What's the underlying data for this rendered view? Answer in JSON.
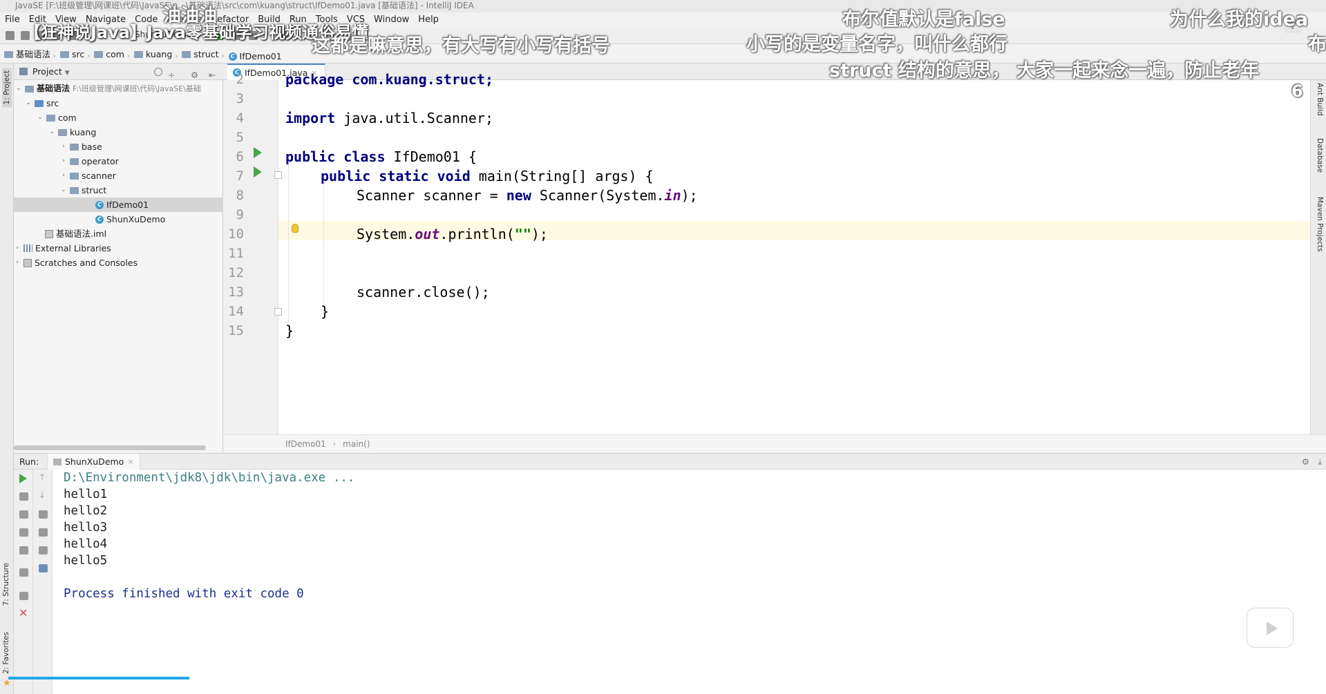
{
  "window": {
    "title": "JavaSE [F:\\班级管理\\网课班\\代码\\JavaSE\\n...\\基础语法\\src\\com\\kuang\\struct\\IfDemo01.java [基础语法] - IntelliJ IDEA",
    "logo": "IJ"
  },
  "menu": [
    "File",
    "Edit",
    "View",
    "Navigate",
    "Code",
    "Analyze",
    "Refactor",
    "Build",
    "Run",
    "Tools",
    "VCS",
    "Window",
    "Help"
  ],
  "toolbar": {
    "config_name": "ShunXuDemo"
  },
  "breadcrumb": [
    "基础语法",
    "src",
    "com",
    "kuang",
    "struct",
    "IfDemo01"
  ],
  "overlays": {
    "video_title": "【狂神说Java】Java零基础学习视频通俗易懂",
    "danmaku": [
      "油油油",
      "这都是嘛意思，有大写有小写有括号",
      "布尔值默认是false",
      "小写的是变量名字，叫什么都行",
      "struct 结构的意思， 大家一起来念一遍，防止老年",
      "为什么我的idea",
      "布",
      "6"
    ],
    "help": "?"
  },
  "left_stripe": {
    "project_tab": "1: Project",
    "structure_tab": "7: Structure",
    "favorites_tab": "2: Favorites"
  },
  "project": {
    "header": "Project",
    "root_name": "基础语法",
    "root_path": "F:\\班级管理\\网课班\\代码\\JavaSE\\基础",
    "nodes": [
      "src",
      "com",
      "kuang",
      "base",
      "operator",
      "scanner",
      "struct",
      "IfDemo01",
      "ShunXuDemo",
      "基础语法.iml",
      "External Libraries",
      "Scratches and Consoles"
    ]
  },
  "editor": {
    "tab": "IfDemo01.java",
    "line_numbers": [
      "2",
      "3",
      "4",
      "5",
      "6",
      "7",
      "8",
      "9",
      "10",
      "11",
      "12",
      "13",
      "14",
      "15"
    ],
    "partial_line": "package com.kuang.struct;",
    "breadcrumb": [
      "IfDemo01",
      "main()"
    ],
    "code": {
      "import_kw": "import",
      "import_rest": " java.util.Scanner;",
      "class_kw": "public class",
      "class_rest": " IfDemo01 {",
      "main_kw": "public static void",
      "main_rest": " main(String[] args) {",
      "scanner_a": "Scanner scanner = ",
      "scanner_new": "new",
      "scanner_b": " Scanner(System.",
      "scanner_in": "in",
      "scanner_c": ");",
      "println_a": "System.",
      "println_out": "out",
      "println_b": ".println(",
      "println_str": "\"\"",
      "println_c": ");",
      "close": "scanner.close();",
      "close_brace_inner": "}",
      "close_brace_outer": "}"
    }
  },
  "right_stripe": [
    "Ant Build",
    "Database",
    "Maven Projects"
  ],
  "run": {
    "label": "Run:",
    "tab": "ShunXuDemo",
    "output": {
      "command": "D:\\Environment\\jdk8\\jdk\\bin\\java.exe ...",
      "lines": [
        "hello1",
        "hello2",
        "hello3",
        "hello4",
        "hello5"
      ],
      "exit": "Process finished with exit code 0"
    }
  },
  "colors": {
    "keyword": "#000080",
    "field": "#660e7a",
    "string": "#008000",
    "console_cmd": "#3d8080",
    "console_exit": "#1c2f8f",
    "run_green": "#4aa44a",
    "progress": "#22a8e6"
  }
}
